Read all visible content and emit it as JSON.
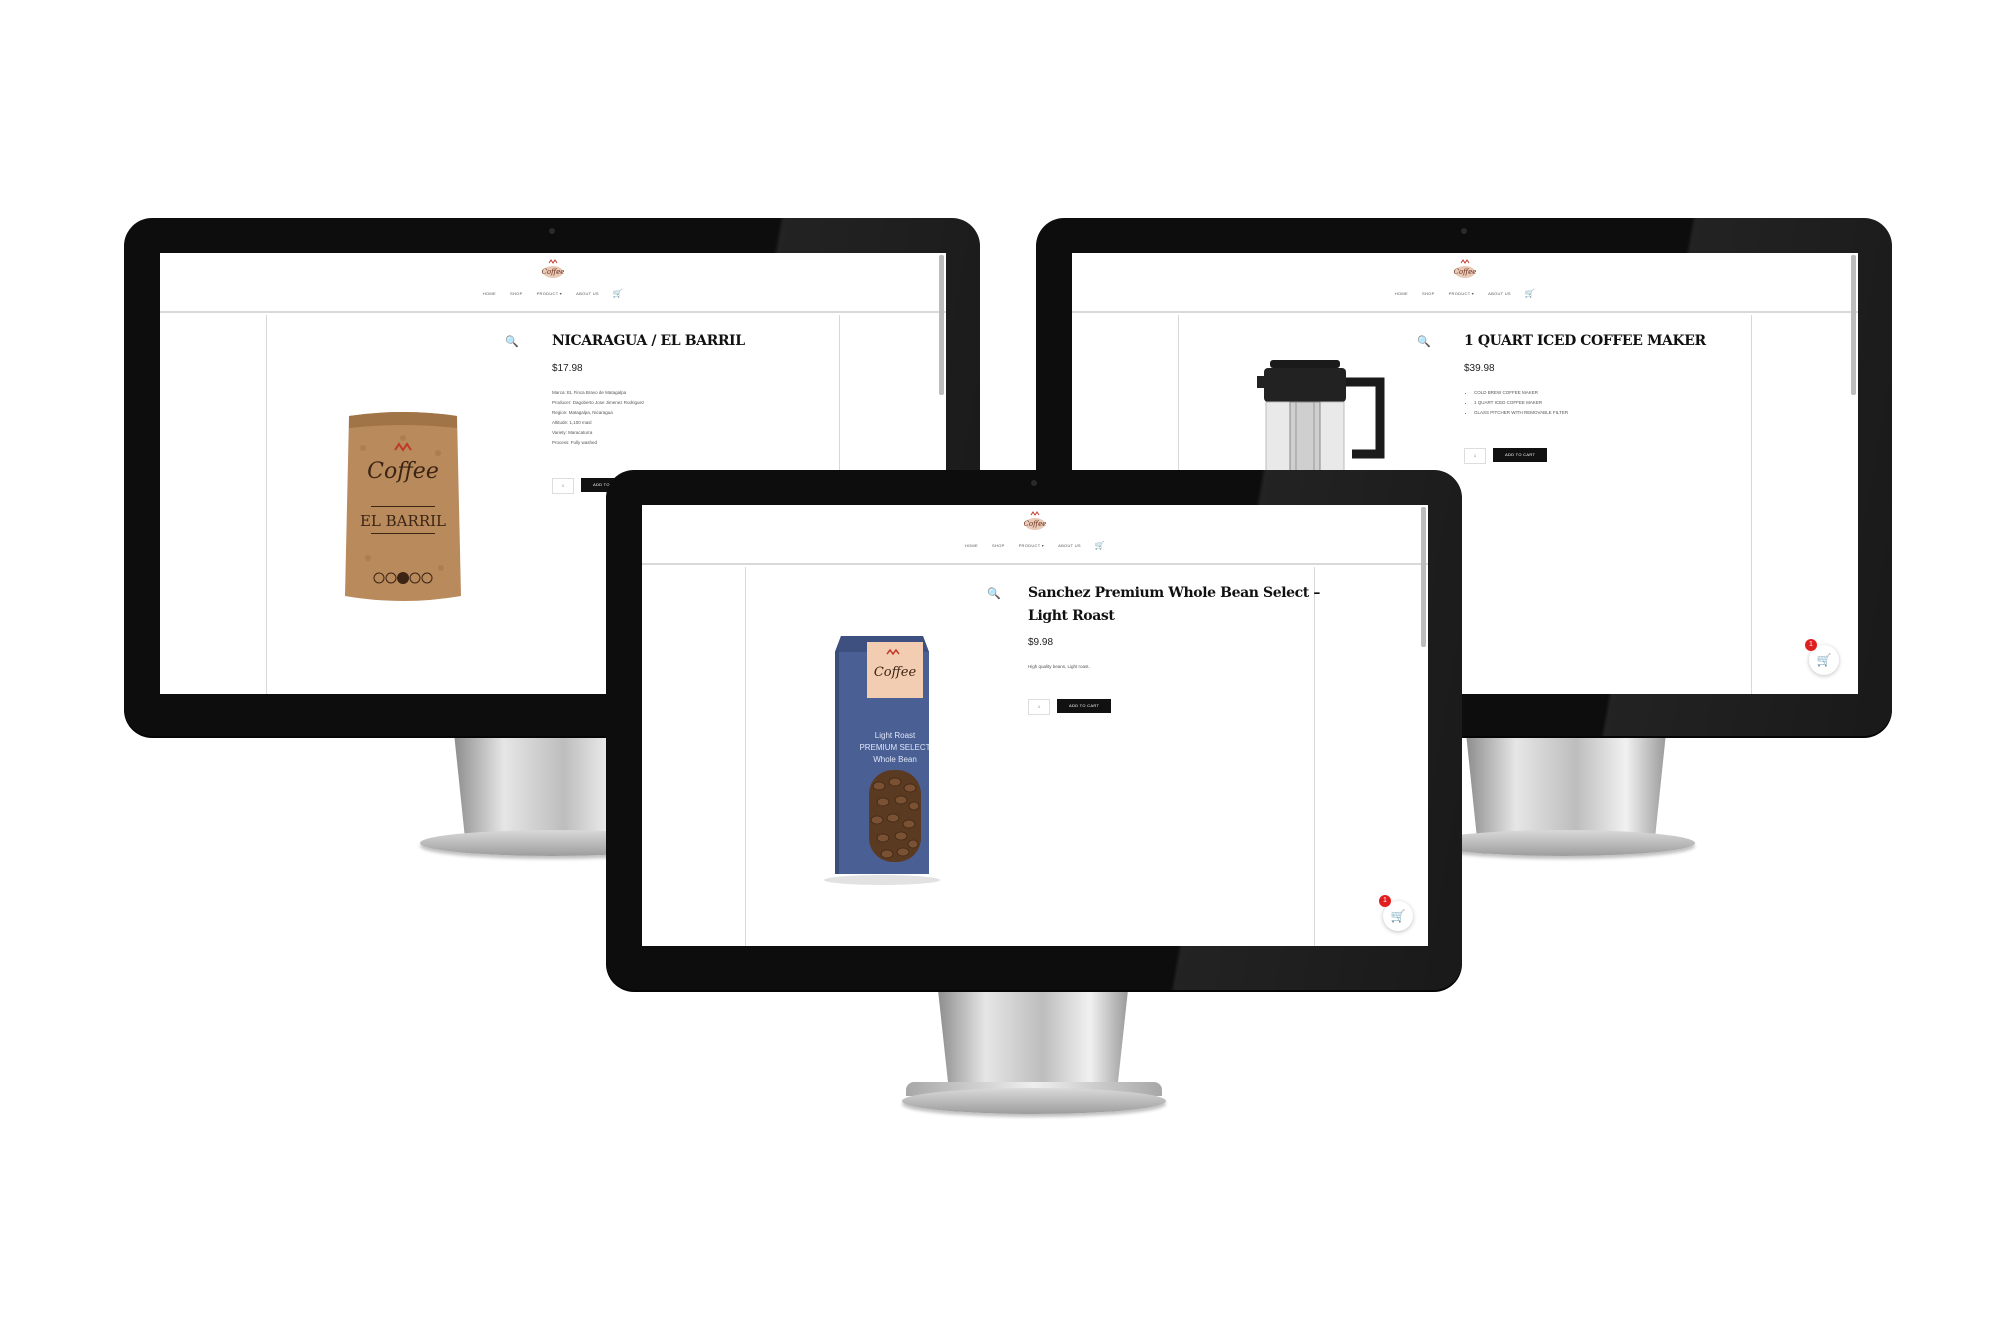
{
  "nav": {
    "items": [
      "HOME",
      "SHOP",
      "PRODUCT ▾",
      "ABOUT US"
    ],
    "cart_icon": "cart-icon"
  },
  "colors": {
    "bezel": "#0d0d0d",
    "button": "#111111",
    "badge": "#e02020"
  },
  "monitors": {
    "left": {
      "title": "NICARAGUA / EL BARRIL",
      "price": "$17.98",
      "details": [
        "Marca: EL Finca Bravo de Matagalpa",
        "Producer: Dagoberto Jose Jimenez Rodriguez",
        "Region: Matagalpa, Nicaragua",
        "Altitude: 1,100 masl",
        "Variety: Maracaturra",
        "Process: Fully washed"
      ],
      "qty": "1",
      "button": "ADD TO CART",
      "bag_brand": "Coffee",
      "bag_name": "EL BARRIL"
    },
    "right": {
      "title": "1 QUART ICED COFFEE MAKER",
      "price": "$39.98",
      "bullets": [
        "COLD BREW COFFEE MAKER",
        "1 QUART ICED COFFEE MAKER",
        "GLASS PITCHER WITH REMOVABLE FILTER"
      ],
      "qty": "1",
      "button": "ADD TO CART",
      "badge": "1"
    },
    "center": {
      "title_line1": "Sanchez Premium Whole Bean Select –",
      "title_line2": "Light Roast",
      "price": "$9.98",
      "description": "High quality beans, Light roast.",
      "qty": "1",
      "button": "ADD TO CART",
      "badge": "1",
      "box_line1": "Light Roast",
      "box_line2": "PREMIUM SELECT",
      "box_line3": "Whole Bean",
      "box_brand": "Coffee"
    }
  }
}
